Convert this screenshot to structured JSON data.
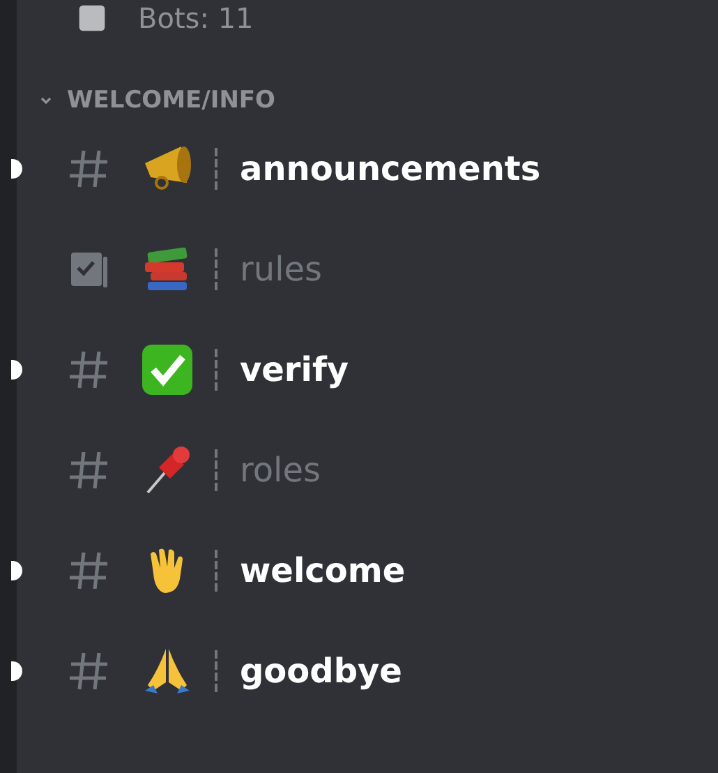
{
  "stats_row": {
    "label": "Bots: 11"
  },
  "category": {
    "name": "WELCOME/INFO",
    "expanded": true
  },
  "channels": [
    {
      "kind": "text",
      "name": "announcements",
      "unread": true
    },
    {
      "kind": "rules",
      "name": "rules",
      "unread": false
    },
    {
      "kind": "text",
      "name": "verify",
      "unread": true
    },
    {
      "kind": "text",
      "name": "roles",
      "unread": false
    },
    {
      "kind": "text",
      "name": "welcome",
      "unread": true
    },
    {
      "kind": "text",
      "name": "goodbye",
      "unread": true
    }
  ]
}
